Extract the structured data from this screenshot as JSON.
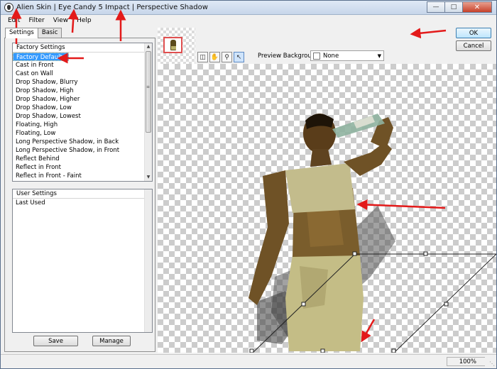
{
  "window": {
    "title": "Alien Skin | Eye Candy 5 Impact | Perspective Shadow",
    "app_icon": "alien-skin-icon",
    "controls": {
      "minimize": "minimize-icon",
      "maximize": "maximize-icon",
      "close": "close-icon"
    }
  },
  "menu": {
    "items": [
      "Edit",
      "Filter",
      "View",
      "Help"
    ]
  },
  "tabs": {
    "settings": "Settings",
    "basic": "Basic"
  },
  "factory": {
    "header": "Factory Settings",
    "items": [
      "Factory Default",
      "Cast in Front",
      "Cast on Wall",
      "Drop Shadow, Blurry",
      "Drop Shadow, High",
      "Drop Shadow, Higher",
      "Drop Shadow, Low",
      "Drop Shadow, Lowest",
      "Floating, High",
      "Floating, Low",
      "Long Perspective Shadow, in Back",
      "Long Perspective Shadow, in Front",
      "Reflect Behind",
      "Reflect in Front",
      "Reflect in Front - Faint"
    ],
    "selected": "Factory Default"
  },
  "user": {
    "header": "User Settings",
    "items": [
      "Last Used"
    ]
  },
  "buttons": {
    "save": "Save",
    "manage": "Manage",
    "ok": "OK",
    "cancel": "Cancel"
  },
  "toolbar": {
    "tools": [
      "before-after-icon",
      "hand-icon",
      "zoom-icon",
      "arrow-icon"
    ],
    "preview_label": "Preview Background:",
    "preview_value": "None"
  },
  "status": {
    "zoom": "100%"
  },
  "colors": {
    "annotation_arrow": "#e31a1a",
    "selection": "#3399ff",
    "ok_border": "#3c7fb1"
  }
}
